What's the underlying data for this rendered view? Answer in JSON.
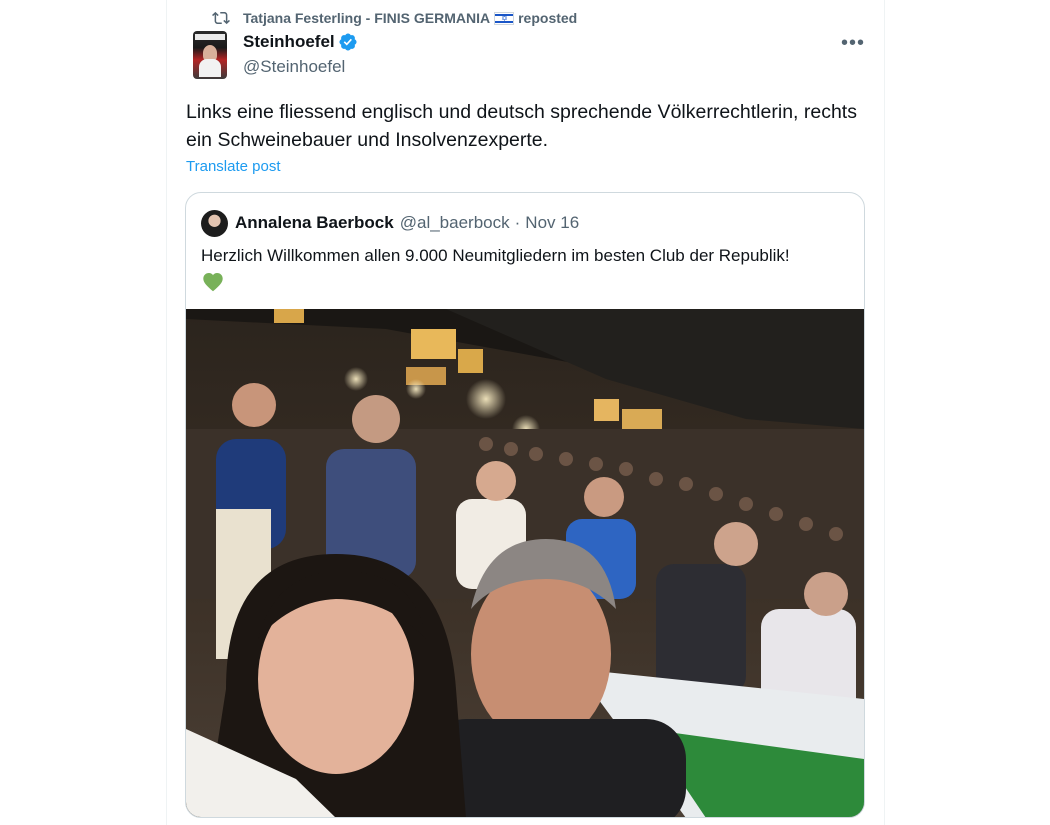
{
  "repost": {
    "reposter": "Tatjana Festerling - FINIS GERMANIA",
    "flag_icon": "israel-flag-icon",
    "suffix": "reposted"
  },
  "post": {
    "author_name": "Steinhoefel",
    "author_handle": "@Steinhoefel",
    "verified": true,
    "more_label": "•••",
    "text": "Links eine fliessend englisch und deutsch sprechende Völkerrechtlerin, rechts ein Schweinebauer und Insolvenzexperte.",
    "translate_label": "Translate post"
  },
  "quote": {
    "author_name": "Annalena Baerbock",
    "author_handle": "@al_baerbock",
    "separator": "·",
    "date": "Nov 16",
    "text": "Herzlich Willkommen allen 9.000 Neumitgliedern im besten Club der Republik!",
    "emoji": "green-heart-icon",
    "media": "selfie-photo-convention-hall"
  },
  "colors": {
    "text_primary": "#0f1419",
    "text_secondary": "#536471",
    "link": "#1d9bf0",
    "verified": "#1d9bf0",
    "border": "#cfd9de",
    "heart": "#78b159"
  }
}
